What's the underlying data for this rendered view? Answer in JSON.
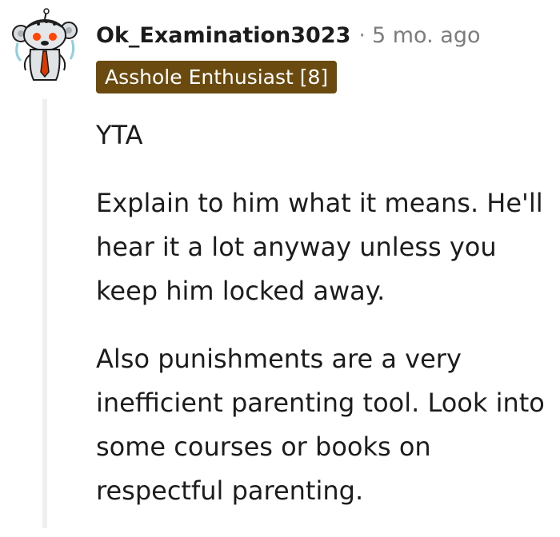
{
  "comment": {
    "username": "Ok_Examination3023",
    "separator": "·",
    "timestamp": "5 mo. ago",
    "flair": "Asshole Enthusiast [8]",
    "paragraphs": [
      "YTA",
      "Explain to him what it means. He'll hear it a lot anyway unless you keep him locked away.",
      "Also punishments are a very inefficient parenting tool. Look into some courses or books on respectful parenting."
    ]
  },
  "colors": {
    "flair_background": "#6b4a10",
    "flair_text": "#ffffff",
    "thread_line": "#edeff1",
    "meta_text": "#7c7c7c"
  },
  "icons": {
    "avatar": "snoo-avatar-icon"
  }
}
